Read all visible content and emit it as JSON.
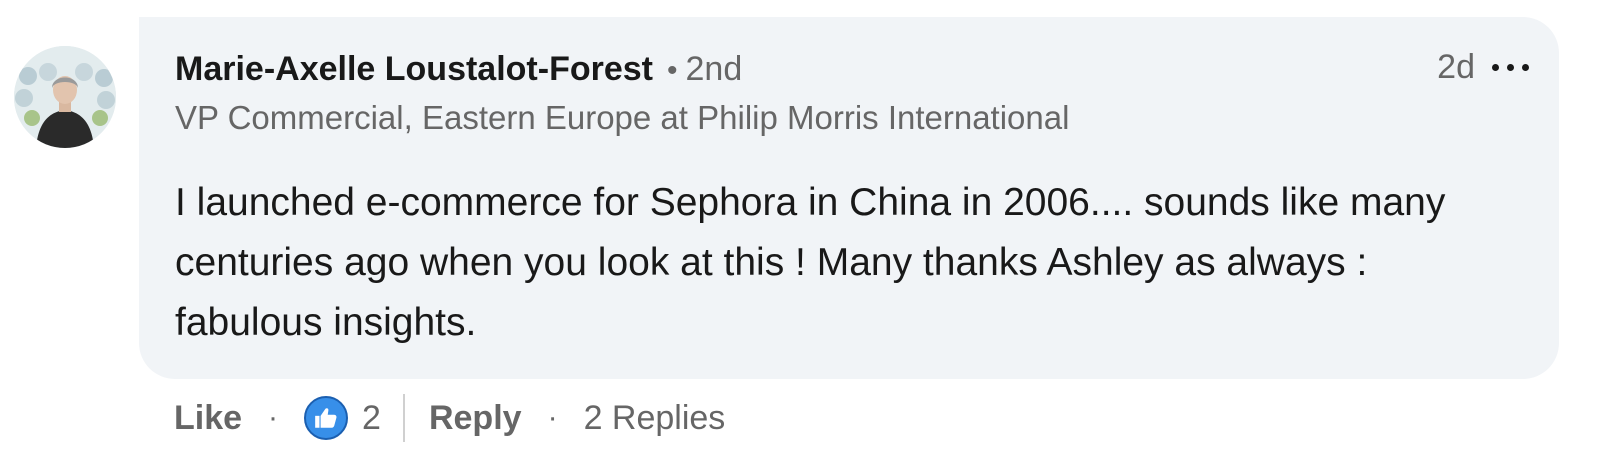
{
  "comment": {
    "author_name": "Marie-Axelle Loustalot-Forest",
    "degree_separator": "•",
    "degree": "2nd",
    "headline": "VP Commercial, Eastern Europe at Philip Morris International",
    "timestamp": "2d",
    "more_icon": "ellipsis-icon",
    "text": "I launched e-commerce for Sephora in China in 2006.... sounds like many centuries ago when you look at this ! Many thanks Ashley as always : fabulous insights."
  },
  "actions": {
    "like_label": "Like",
    "separator": "·",
    "reaction_icon": "thumbs-up-icon",
    "reaction_count": "2",
    "reply_label": "Reply",
    "replies_label": "2 Replies"
  },
  "colors": {
    "bubble_background": "#f1f4f7",
    "secondary_text": "#666666",
    "primary_text": "#191919",
    "like_blue": "#378fe9"
  }
}
